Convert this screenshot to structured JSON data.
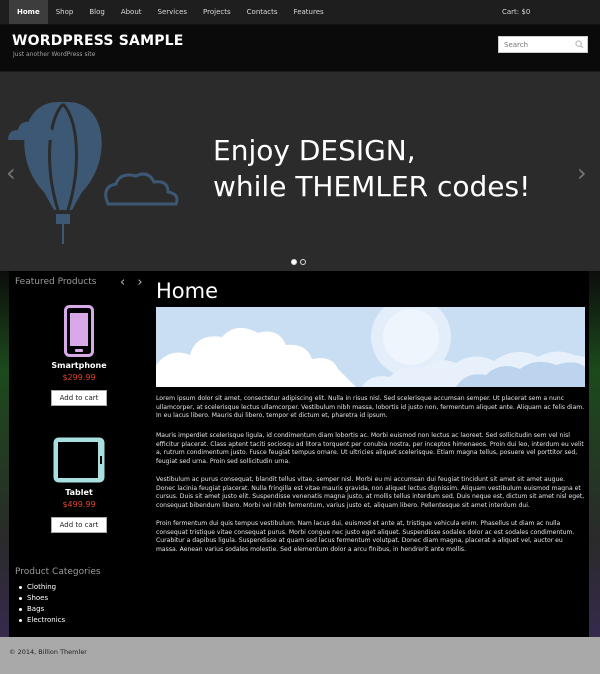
{
  "nav": {
    "items": [
      "Home",
      "Shop",
      "Blog",
      "About",
      "Services",
      "Projects",
      "Contacts",
      "Features"
    ],
    "active": "Home",
    "cart": "Cart: $0"
  },
  "header": {
    "title": "WORDPRESS SAMPLE",
    "tagline": "Just another WordPress site",
    "search_placeholder": "Search",
    "search_icon": "search-icon"
  },
  "slider": {
    "line1": "Enjoy DESIGN,",
    "line2": "while THEMLER codes!",
    "prev_icon": "‹",
    "next_icon": "›",
    "slide_count": 2,
    "active_slide": 1
  },
  "sidebar": {
    "featured_heading": "Featured Products",
    "featured_nav": "‹ ›",
    "products": [
      {
        "name": "Smartphone",
        "price": "$299.99",
        "button": "Add to cart",
        "icon": "smartphone-icon"
      },
      {
        "name": "Tablet",
        "price": "$499.99",
        "button": "Add to cart",
        "icon": "tablet-icon"
      }
    ],
    "categories_heading": "Product Categories",
    "categories": [
      "Clothing",
      "Shoes",
      "Bags",
      "Electronics"
    ]
  },
  "main": {
    "title": "Home",
    "paragraphs": [
      "Lorem ipsum dolor sit amet, consectetur adipiscing elit. Nulla in risus nisl. Sed scelerisque accumsan semper. Ut placerat sem a nunc ullamcorper, at scelerisque lectus ullamcorper. Vestibulum nibh massa, lobortis id justo non, fermentum aliquet ante. Aliquam ac felis diam. In eu lacus libero. Mauris dui libero, tempor et dictum et, pharetra id ipsum.",
      "Mauris imperdiet scelerisque ligula, id condimentum diam lobortis ac. Morbi euismod non lectus ac laoreet. Sed sollicitudin sem vel nisl efficitur placerat. Class aptent taciti sociosqu ad litora torquent per conubia nostra, per inceptos himenaeos. Proin dui leo, interdum eu velit a, rutrum condimentum justo. Fusce feugiat tempus ornare. Ut ultricies aliquet scelerisque. Etiam magna tellus, posuere vel porttitor sed, feugiat sed urna. Proin sed sollicitudin urna.",
      "Vestibulum ac purus consequat, blandit tellus vitae, semper nisl. Morbi eu mi accumsan dui feugiat tincidunt sit amet sit amet augue. Donec lacinia feugiat placerat. Nulla fringilla est vitae mauris gravida, non aliquet lectus dignissim. Aliquam vestibulum euismod magna et cursus. Duis sit amet justo elit. Suspendisse venenatis magna justo, at mollis tellus interdum sed. Duis neque est, dictum sit amet nisl eget, consequat bibendum libero. Morbi vel nibh fermentum, varius justo et, aliquam libero. Pellentesque sit amet interdum dui.",
      "Proin fermentum dui quis tempus vestibulum. Nam lacus dui, euismod et ante at, tristique vehicula enim. Phasellus ut diam ac nulla consequat tristique vitae consequat purus. Morbi congue nec justo eget aliquet. Suspendisse sodales dolor ac est sodales condimentum. Curabitur a dapibus ligula. Suspendisse at quam sed lacus fermentum volutpat. Donec diam magna, placerat a aliquet vel, auctor eu massa. Aenean varius sodales molestie. Sed elementum dolor a arcu finibus, in hendrerit ante mollis."
    ]
  },
  "footer": {
    "copyright": "© 2014, Billion Themler"
  },
  "colors": {
    "nav_bg": "#1e1e1e",
    "slider_bg": "#2b2b2b",
    "balloon": "#3d5874",
    "price": "#e0452a",
    "phone_icon": "#d8a8e8",
    "tablet_icon": "#a8e0e0",
    "footer_bg": "#a9a9a9"
  }
}
